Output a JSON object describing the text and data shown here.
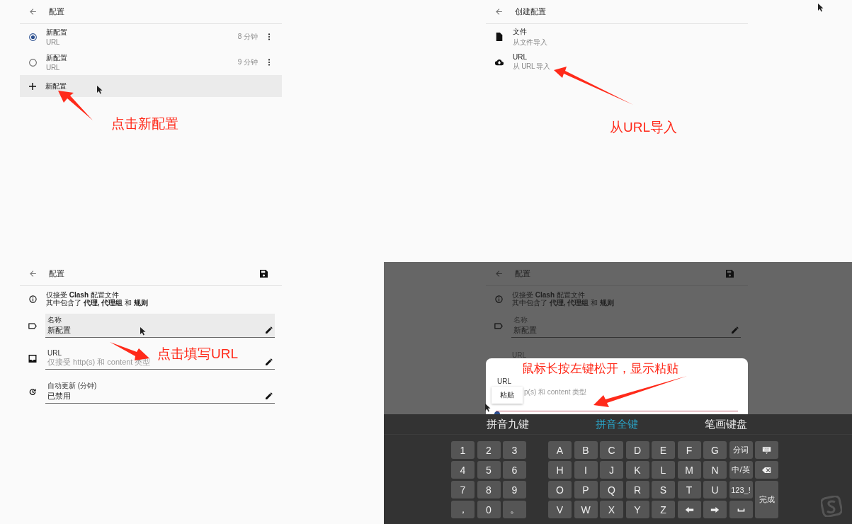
{
  "profiles_screen": {
    "title": "配置",
    "items": [
      {
        "name": "新配置",
        "type": "URL",
        "time": "8 分钟",
        "selected": true
      },
      {
        "name": "新配置",
        "type": "URL",
        "time": "9 分钟",
        "selected": false
      }
    ],
    "add_row": {
      "label": "新配置",
      "highlighted": true
    },
    "annotation": "点击新配置"
  },
  "create_screen": {
    "title": "创建配置",
    "items": [
      {
        "kind": "file",
        "title": "文件",
        "subtitle": "从文件导入"
      },
      {
        "kind": "url",
        "title": "URL",
        "subtitle": "从 URL 导入"
      }
    ],
    "annotation": "从URL导入"
  },
  "edit_screen": {
    "title": "配置",
    "notice": [
      "仅接受 **Clash** 配置文件",
      "其中包含了 **代理, 代理组** 和 **规则**"
    ],
    "fields": [
      {
        "kind": "name",
        "label": "名称",
        "value": "新配置",
        "highlighted": true
      },
      {
        "kind": "url",
        "label": "URL",
        "placeholder": "仅接受 http(s) 和 content 类型",
        "highlighted": false
      },
      {
        "kind": "interval",
        "label": "自动更新 (分钟)",
        "value": "已禁用",
        "highlighted": false
      }
    ],
    "annotation": "点击填写URL"
  },
  "paste_screen": {
    "title": "配置",
    "notice": [
      "仅接受 **Clash** 配置文件",
      "其中包含了 **代理, 代理组** 和 **规则**"
    ],
    "name_field": {
      "label": "名称",
      "value": "新配置"
    },
    "url_label": "URL",
    "sheet": {
      "label": "URL",
      "placeholder": "p(s) 和 content 类型",
      "popup": "粘贴"
    },
    "annotation": "鼠标长按左键松开，显示粘贴",
    "keyboard": {
      "tabs": [
        {
          "label": "拼音九键",
          "selected": false
        },
        {
          "label": "拼音全键",
          "selected": true
        },
        {
          "label": "笔画键盘",
          "selected": false
        }
      ],
      "numpad": [
        "1",
        "2",
        "3",
        "4",
        "5",
        "6",
        "7",
        "8",
        "9",
        "，",
        "0",
        "。"
      ],
      "keys": [
        {
          "kind": "text",
          "label": "A"
        },
        {
          "kind": "text",
          "label": "B"
        },
        {
          "kind": "text",
          "label": "C"
        },
        {
          "kind": "text",
          "label": "D"
        },
        {
          "kind": "text",
          "label": "E"
        },
        {
          "kind": "text",
          "label": "F"
        },
        {
          "kind": "text",
          "label": "G"
        },
        {
          "kind": "text",
          "label": "分词"
        },
        {
          "kind": "hide"
        },
        {
          "kind": "text",
          "label": "H"
        },
        {
          "kind": "text",
          "label": "I"
        },
        {
          "kind": "text",
          "label": "J"
        },
        {
          "kind": "text",
          "label": "K"
        },
        {
          "kind": "text",
          "label": "L"
        },
        {
          "kind": "text",
          "label": "M"
        },
        {
          "kind": "text",
          "label": "N"
        },
        {
          "kind": "text",
          "label": "中/英"
        },
        {
          "kind": "backspace"
        },
        {
          "kind": "text",
          "label": "O"
        },
        {
          "kind": "text",
          "label": "P"
        },
        {
          "kind": "text",
          "label": "Q"
        },
        {
          "kind": "text",
          "label": "R"
        },
        {
          "kind": "text",
          "label": "S"
        },
        {
          "kind": "text",
          "label": "T"
        },
        {
          "kind": "text",
          "label": "U"
        },
        {
          "kind": "text",
          "label": "123_!"
        },
        {
          "kind": "tall",
          "label": "完成"
        },
        {
          "kind": "text",
          "label": "V"
        },
        {
          "kind": "text",
          "label": "W"
        },
        {
          "kind": "text",
          "label": "X"
        },
        {
          "kind": "text",
          "label": "Y"
        },
        {
          "kind": "text",
          "label": "Z"
        },
        {
          "kind": "left"
        },
        {
          "kind": "right"
        },
        {
          "kind": "space"
        }
      ]
    }
  }
}
